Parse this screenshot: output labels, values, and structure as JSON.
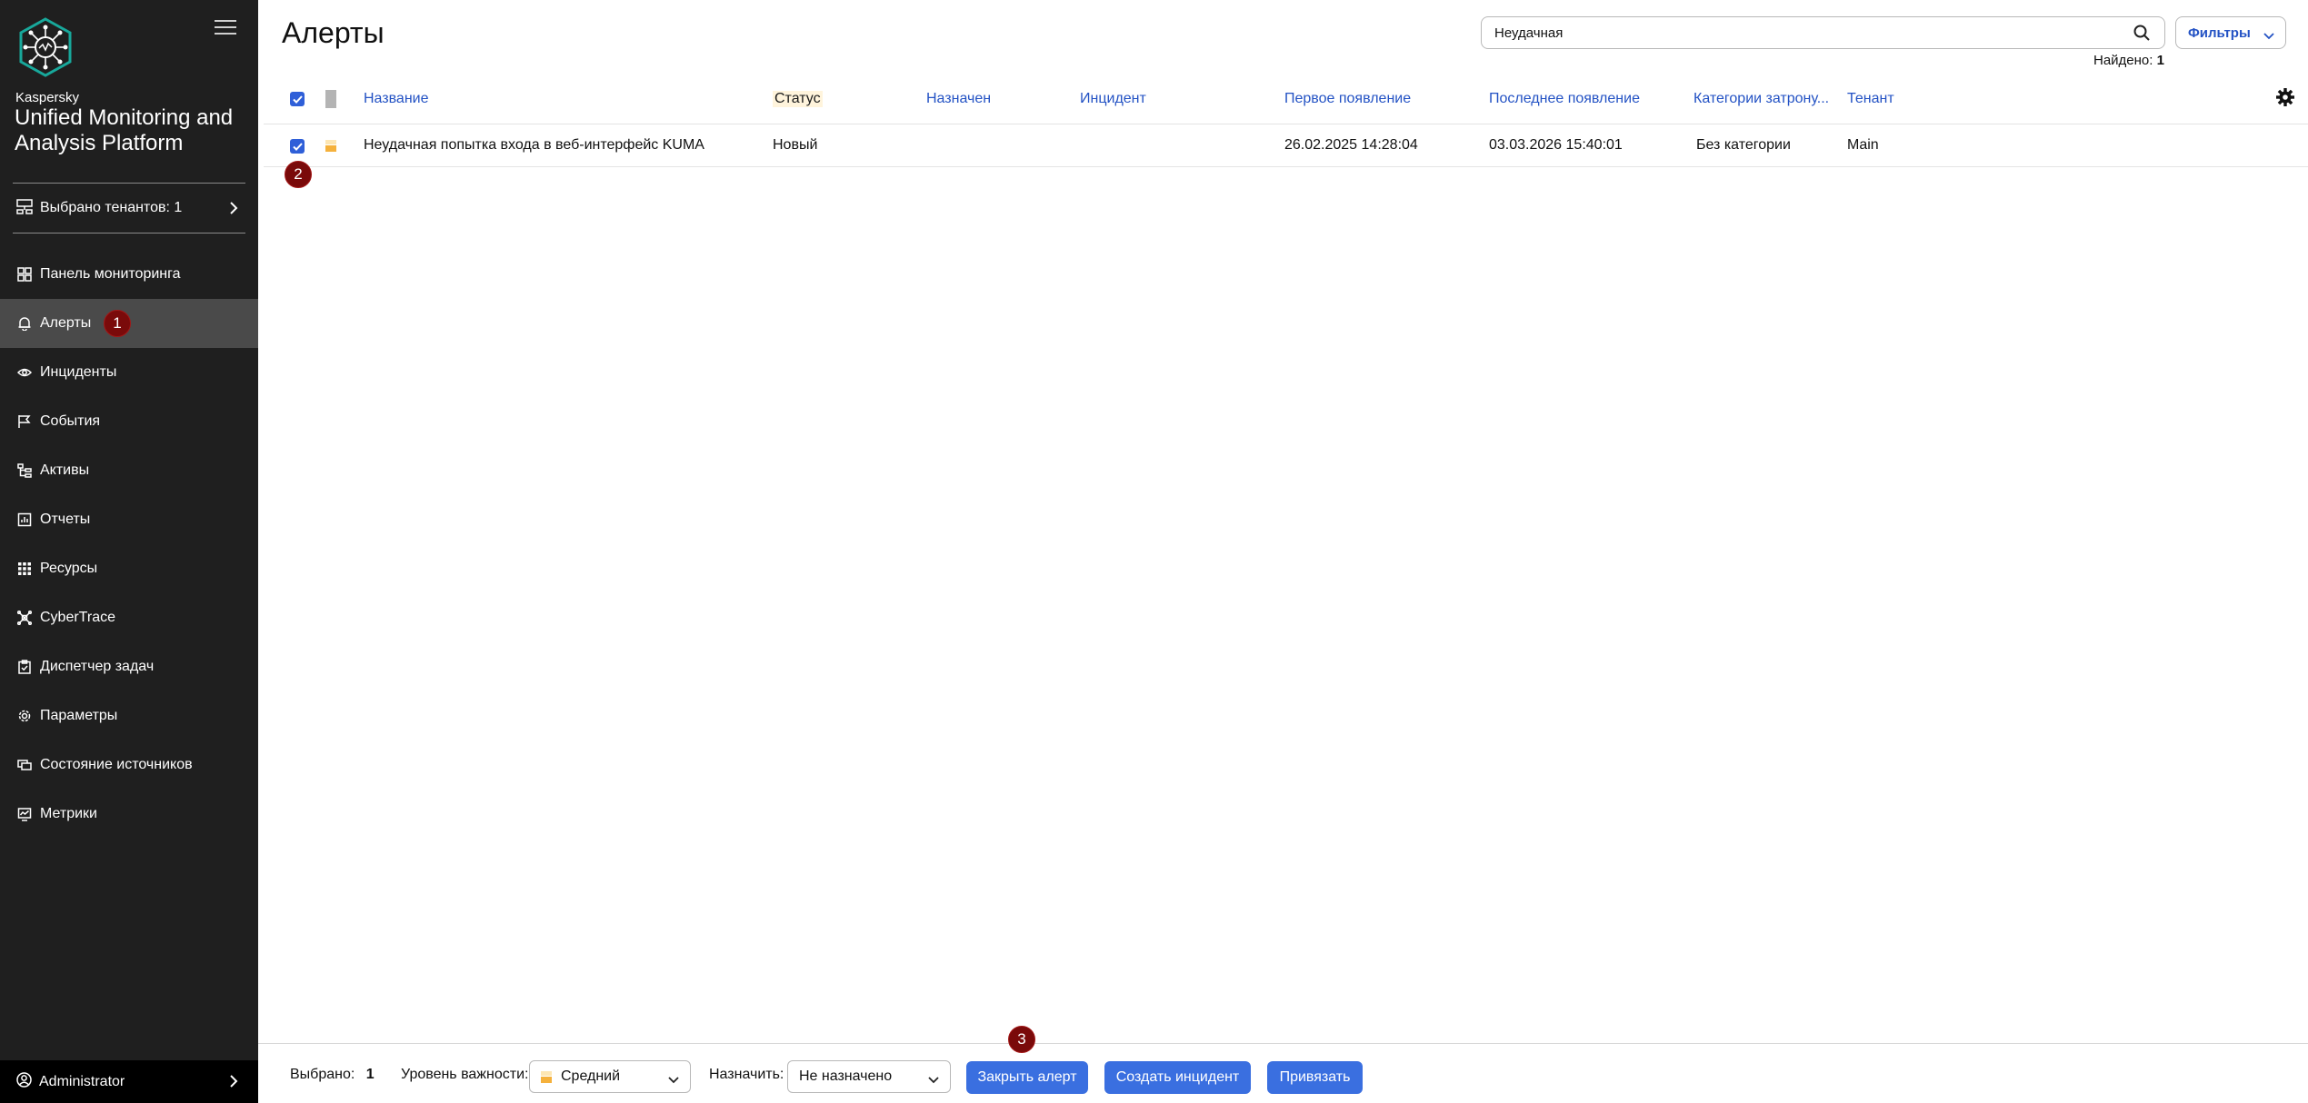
{
  "sidebar": {
    "brand_small": "Kaspersky",
    "brand_title": "Unified Monitoring and Analysis Platform",
    "tenants_label": "Выбрано тенантов: 1",
    "items": [
      {
        "label": "Панель мониторинга",
        "icon": "dashboard-icon"
      },
      {
        "label": "Алерты",
        "icon": "bell-icon",
        "active": true,
        "badge": "1"
      },
      {
        "label": "Инциденты",
        "icon": "eye-icon"
      },
      {
        "label": "События",
        "icon": "flag-icon"
      },
      {
        "label": "Активы",
        "icon": "tree-icon"
      },
      {
        "label": "Отчеты",
        "icon": "report-icon"
      },
      {
        "label": "Ресурсы",
        "icon": "grid-icon"
      },
      {
        "label": "CyberTrace",
        "icon": "cybertrace-icon"
      },
      {
        "label": "Диспетчер задач",
        "icon": "task-icon"
      },
      {
        "label": "Параметры",
        "icon": "gear-icon"
      },
      {
        "label": "Состояние источников",
        "icon": "sources-icon"
      },
      {
        "label": "Метрики",
        "icon": "metrics-icon"
      }
    ],
    "user": "Administrator"
  },
  "header": {
    "title": "Алерты",
    "search_value": "Неудачная",
    "filters_label": "Фильтры",
    "found_label": "Найдено:",
    "found_count": "1"
  },
  "table": {
    "columns": {
      "name": "Название",
      "status": "Статус",
      "assigned": "Назначен",
      "incident": "Инцидент",
      "first_seen": "Первое появление",
      "last_seen": "Последнее появление",
      "categories": "Категории затрону...",
      "tenant": "Тенант"
    },
    "rows": [
      {
        "name": "Неудачная попытка входа в веб-интерфейс KUMA",
        "status": "Новый",
        "assigned": "",
        "incident": "",
        "first_seen": "26.02.2025 14:28:04",
        "last_seen": "03.03.2026 15:40:01",
        "categories": "Без категории",
        "tenant": "Main",
        "severity": "medium"
      }
    ],
    "row_badge": "2"
  },
  "bottombar": {
    "selected_label": "Выбрано:",
    "selected_count": "1",
    "severity_label": "Уровень важности:",
    "severity_value": "Средний",
    "assign_label": "Назначить:",
    "assign_value": "Не назначено",
    "close_btn": "Закрыть алерт",
    "create_btn": "Создать инцидент",
    "link_btn": "Привязать",
    "close_badge": "3"
  },
  "colors": {
    "sidebar_bg": "#1f1f1f",
    "active_item": "#4a4a4a",
    "accent_blue": "#2352c4",
    "button_blue": "#3a6fe0",
    "badge_red": "#7a0a0a",
    "severity_medium": "#f5b13c"
  }
}
